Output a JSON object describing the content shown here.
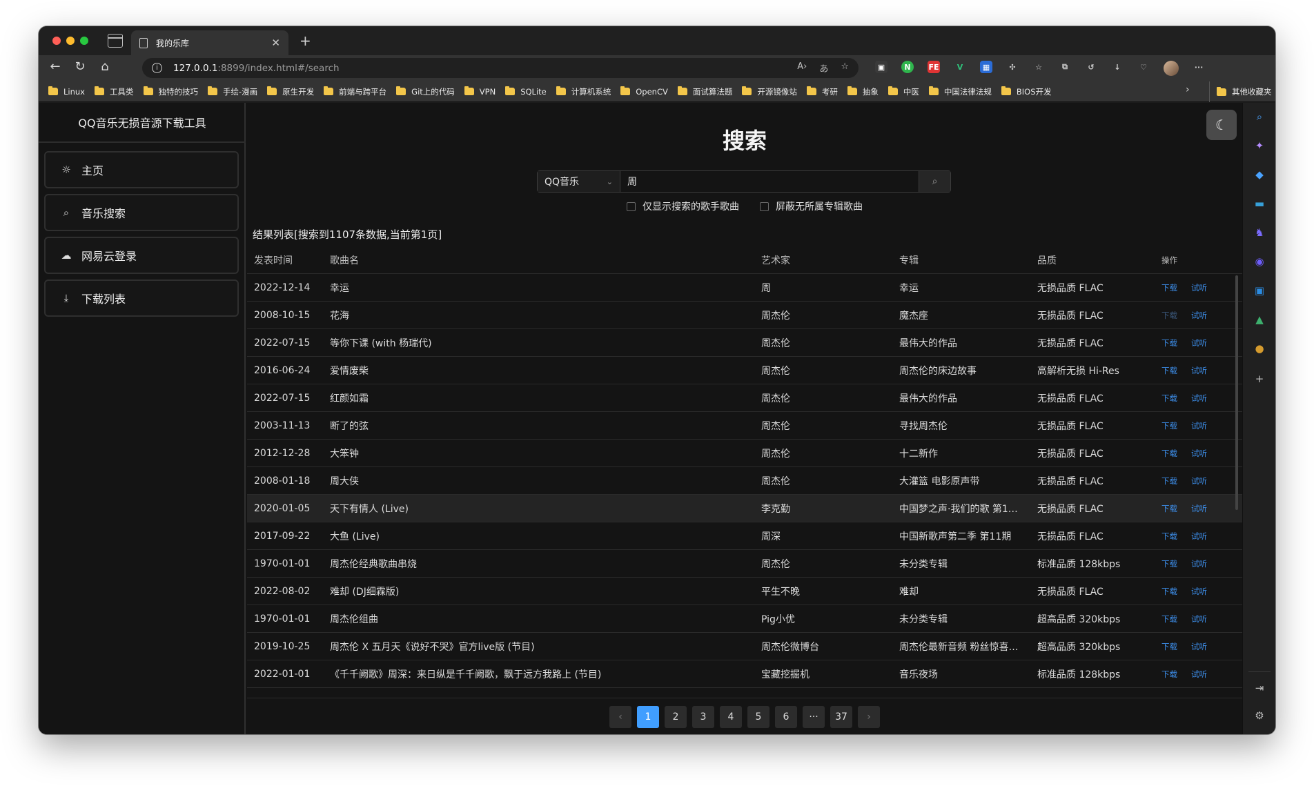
{
  "browser": {
    "tab_title": "我的乐库",
    "url_host": "127.0.0.1",
    "url_rest": ":8899/index.html#/search",
    "bookmarks": [
      "Linux",
      "工具类",
      "独特的技巧",
      "手绘-漫画",
      "原生开发",
      "前端与跨平台",
      "Git上的代码",
      "VPN",
      "SQLite",
      "计算机系统",
      "OpenCV",
      "面试算法题",
      "开源镜像站",
      "考研",
      "抽象",
      "中医",
      "中国法律法规",
      "BIOS开发"
    ],
    "other_bookmarks": "其他收藏夹"
  },
  "sidebar": {
    "app_title": "QQ音乐无损音源下载工具",
    "items": [
      {
        "label": "主页",
        "icon": "sun-icon"
      },
      {
        "label": "音乐搜索",
        "icon": "search-icon"
      },
      {
        "label": "网易云登录",
        "icon": "cloud-icon"
      },
      {
        "label": "下载列表",
        "icon": "download-icon"
      }
    ]
  },
  "search": {
    "page_title": "搜索",
    "source": "QQ音乐",
    "query": "周",
    "option_singer_only": "仅显示搜索的歌手歌曲",
    "option_hide_no_album": "屏蔽无所属专辑歌曲",
    "result_label": "结果列表[搜索到1107条数据,当前第1页]"
  },
  "table": {
    "headers": {
      "date": "发表时间",
      "song": "歌曲名",
      "artist": "艺术家",
      "album": "专辑",
      "quality": "品质",
      "ops": "操作"
    },
    "download_label": "下载",
    "play_label": "试听",
    "rows": [
      {
        "date": "2022-12-14",
        "song": "幸运",
        "artist": "周",
        "album": "幸运",
        "quality": "无损品质 FLAC"
      },
      {
        "date": "2008-10-15",
        "song": "花海",
        "artist": "周杰伦",
        "album": "魔杰座",
        "quality": "无损品质 FLAC"
      },
      {
        "date": "2022-07-15",
        "song": "等你下课 (with 杨瑞代)",
        "artist": "周杰伦",
        "album": "最伟大的作品",
        "quality": "无损品质 FLAC"
      },
      {
        "date": "2016-06-24",
        "song": "爱情废柴",
        "artist": "周杰伦",
        "album": "周杰伦的床边故事",
        "quality": "高解析无损 Hi-Res"
      },
      {
        "date": "2022-07-15",
        "song": "红颜如霜",
        "artist": "周杰伦",
        "album": "最伟大的作品",
        "quality": "无损品质 FLAC"
      },
      {
        "date": "2003-11-13",
        "song": "断了的弦",
        "artist": "周杰伦",
        "album": "寻找周杰伦",
        "quality": "无损品质 FLAC"
      },
      {
        "date": "2012-12-28",
        "song": "大笨钟",
        "artist": "周杰伦",
        "album": "十二新作",
        "quality": "无损品质 FLAC"
      },
      {
        "date": "2008-01-18",
        "song": "周大侠",
        "artist": "周杰伦",
        "album": "大灌篮 电影原声带",
        "quality": "无损品质 FLAC"
      },
      {
        "date": "2020-01-05",
        "song": "天下有情人 (Live)",
        "artist": "李克勤",
        "album": "中国梦之声·我们的歌 第1…",
        "quality": "无损品质 FLAC"
      },
      {
        "date": "2017-09-22",
        "song": "大鱼 (Live)",
        "artist": "周深",
        "album": "中国新歌声第二季 第11期",
        "quality": "无损品质 FLAC"
      },
      {
        "date": "1970-01-01",
        "song": "周杰伦经典歌曲串烧",
        "artist": "周杰伦",
        "album": "未分类专辑",
        "quality": "标准品质 128kbps"
      },
      {
        "date": "2022-08-02",
        "song": "难却 (DJ细霖版)",
        "artist": "平生不晚",
        "album": "难却",
        "quality": "无损品质 FLAC"
      },
      {
        "date": "1970-01-01",
        "song": "周杰伦组曲",
        "artist": "Pig小优",
        "album": "未分类专辑",
        "quality": "超高品质 320kbps"
      },
      {
        "date": "2019-10-25",
        "song": "周杰伦 X 五月天《说好不哭》官方live版 (节目)",
        "artist": "周杰伦微博台",
        "album": "周杰伦最新音频 粉丝惊喜…",
        "quality": "超高品质 320kbps"
      },
      {
        "date": "2022-01-01",
        "song": "《千千阙歌》周深：来日纵是千千阙歌，飘于远方我路上 (节目)",
        "artist": "宝藏挖掘机",
        "album": "音乐夜场",
        "quality": "标准品质 128kbps"
      }
    ]
  },
  "pagination": {
    "pages": [
      "1",
      "2",
      "3",
      "4",
      "5",
      "6",
      "···",
      "37"
    ],
    "current": "1"
  },
  "colors": {
    "accent": "#409eff",
    "link": "#3d8eea",
    "background": "#141414"
  }
}
